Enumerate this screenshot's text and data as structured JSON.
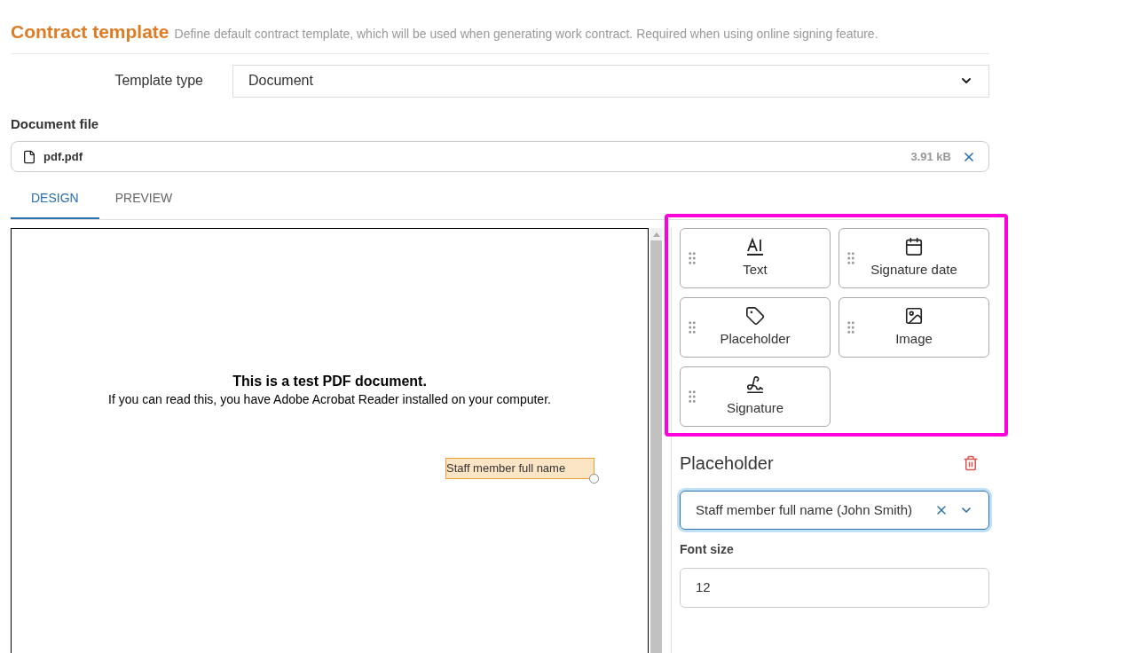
{
  "header": {
    "title": "Contract template",
    "description": "Define default contract template, which will be used when generating work contract. Required when using online signing feature."
  },
  "template_type": {
    "label": "Template type",
    "value": "Document"
  },
  "document_file": {
    "label": "Document file",
    "file_name": "pdf.pdf",
    "size": "3.91 kB"
  },
  "tabs": [
    {
      "label": "DESIGN",
      "selected": true
    },
    {
      "label": "PREVIEW",
      "selected": false
    }
  ],
  "document": {
    "title": "This is a test PDF document.",
    "body": "If you can read this, you have Adobe Acrobat Reader installed on your computer.",
    "fields": [
      {
        "label": "Staff member full name"
      }
    ]
  },
  "palette": {
    "highlighted": true,
    "items": [
      {
        "label": "Text",
        "kind": "text"
      },
      {
        "label": "Signature date",
        "kind": "date"
      },
      {
        "label": "Placeholder",
        "kind": "placeholder"
      },
      {
        "label": "Image",
        "kind": "image"
      },
      {
        "label": "Signature",
        "kind": "signature"
      }
    ]
  },
  "properties": {
    "title": "Placeholder",
    "placeholder_select": {
      "value": "Staff member full name (John Smith)",
      "focused": true
    },
    "font_size": {
      "label": "Font size",
      "value": "12"
    }
  }
}
